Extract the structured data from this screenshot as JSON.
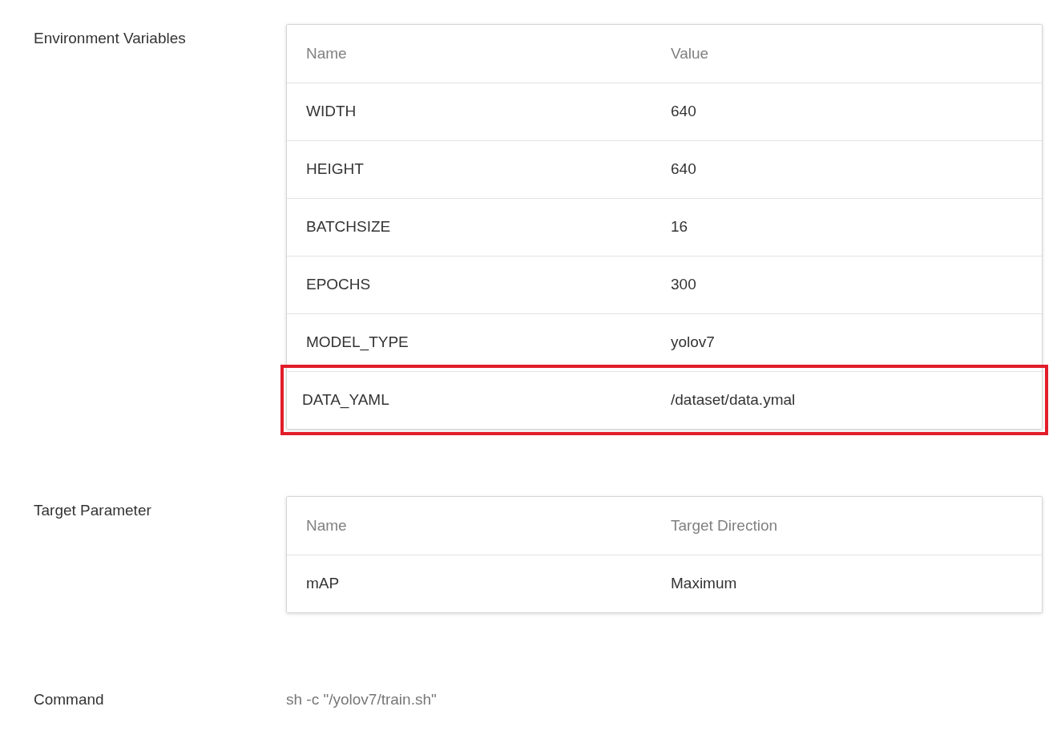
{
  "sections": [
    {
      "kind": "table",
      "label": "Environment Variables",
      "columns": [
        "Name",
        "Value"
      ],
      "rows": [
        {
          "cells": [
            "WIDTH",
            "640"
          ],
          "highlighted": false
        },
        {
          "cells": [
            "HEIGHT",
            "640"
          ],
          "highlighted": false
        },
        {
          "cells": [
            "BATCHSIZE",
            "16"
          ],
          "highlighted": false
        },
        {
          "cells": [
            "EPOCHS",
            "300"
          ],
          "highlighted": false
        },
        {
          "cells": [
            "MODEL_TYPE",
            "yolov7"
          ],
          "highlighted": false
        },
        {
          "cells": [
            "DATA_YAML",
            "/dataset/data.ymal"
          ],
          "highlighted": true
        }
      ]
    },
    {
      "kind": "table",
      "label": "Target Parameter",
      "columns": [
        "Name",
        "Target Direction"
      ],
      "rows": [
        {
          "cells": [
            "mAP",
            "Maximum"
          ],
          "highlighted": false
        }
      ]
    },
    {
      "kind": "text",
      "label": "Command",
      "value": "sh -c \"/yolov7/train.sh\""
    }
  ]
}
